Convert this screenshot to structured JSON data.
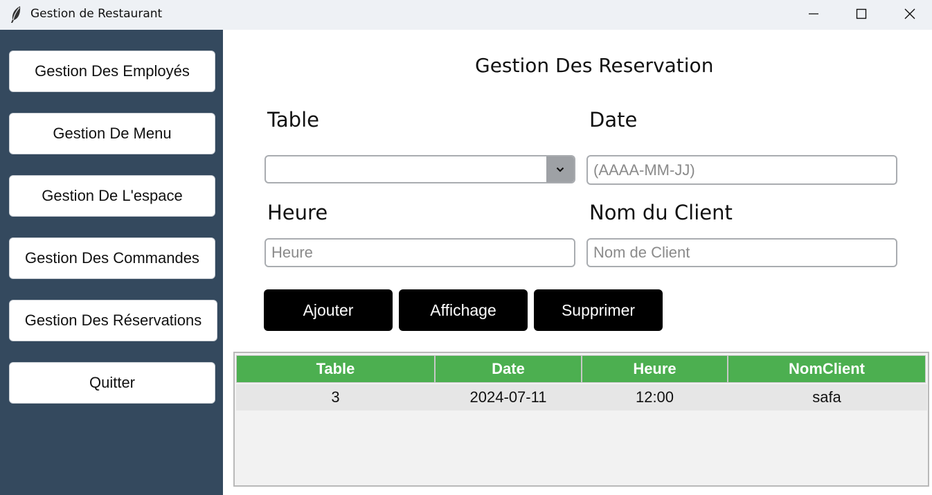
{
  "window": {
    "title": "Gestion de Restaurant",
    "icon": "feather-icon"
  },
  "sidebar": {
    "items": [
      {
        "label": "Gestion Des Employés"
      },
      {
        "label": "Gestion De Menu"
      },
      {
        "label": "Gestion De L'espace"
      },
      {
        "label": "Gestion Des Commandes"
      },
      {
        "label": "Gestion Des Réservations"
      },
      {
        "label": "Quitter"
      }
    ]
  },
  "form": {
    "title": "Gestion Des Reservation",
    "table_label": "Table",
    "table_value": "",
    "date_label": "Date",
    "date_placeholder": "(AAAA-MM-JJ)",
    "heure_label": "Heure",
    "heure_placeholder": "Heure",
    "client_label": "Nom du Client",
    "client_placeholder": "Nom de Client"
  },
  "actions": {
    "add": "Ajouter",
    "show": "Affichage",
    "delete": "Supprimer"
  },
  "table": {
    "columns": [
      "Table",
      "Date",
      "Heure",
      "NomClient"
    ],
    "rows": [
      [
        "3",
        "2024-07-11",
        "12:00",
        "safa"
      ]
    ]
  },
  "colors": {
    "sidebar_bg": "#34495e",
    "header_green": "#4caf50",
    "button_black": "#000000"
  }
}
